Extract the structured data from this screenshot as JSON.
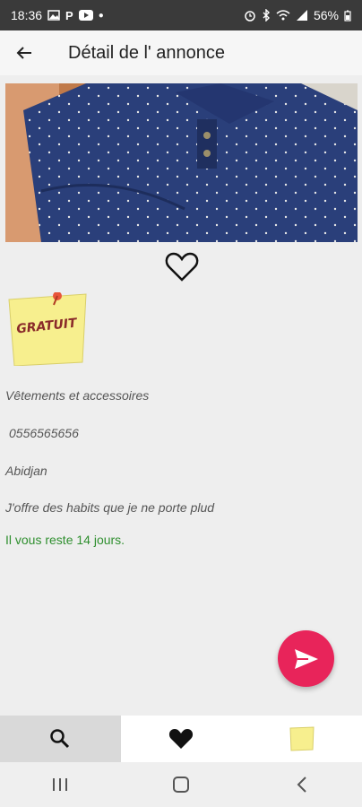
{
  "status": {
    "time": "18:36",
    "battery": "56%",
    "icons_left": [
      "image-icon",
      "p-icon",
      "youtube-icon",
      "dot-icon"
    ],
    "icons_right": [
      "alarm-icon",
      "bluetooth-icon",
      "wifi-icon",
      "signal-icon",
      "battery-icon"
    ]
  },
  "header": {
    "title": "Détail de l' annonce"
  },
  "listing": {
    "price_label": "GRATUIT",
    "category": "Vêtements et accessoires",
    "phone": "0556565656",
    "city": "Abidjan",
    "description": "J'offre des habits que je ne porte plud",
    "remaining": "Il vous reste 14 jours."
  },
  "bottom_nav": [
    "search-icon",
    "heart-icon",
    "note-icon"
  ],
  "colors": {
    "accent": "#e8245a",
    "status_green": "#2f8f2f",
    "shirt": "#2a3f7a"
  }
}
